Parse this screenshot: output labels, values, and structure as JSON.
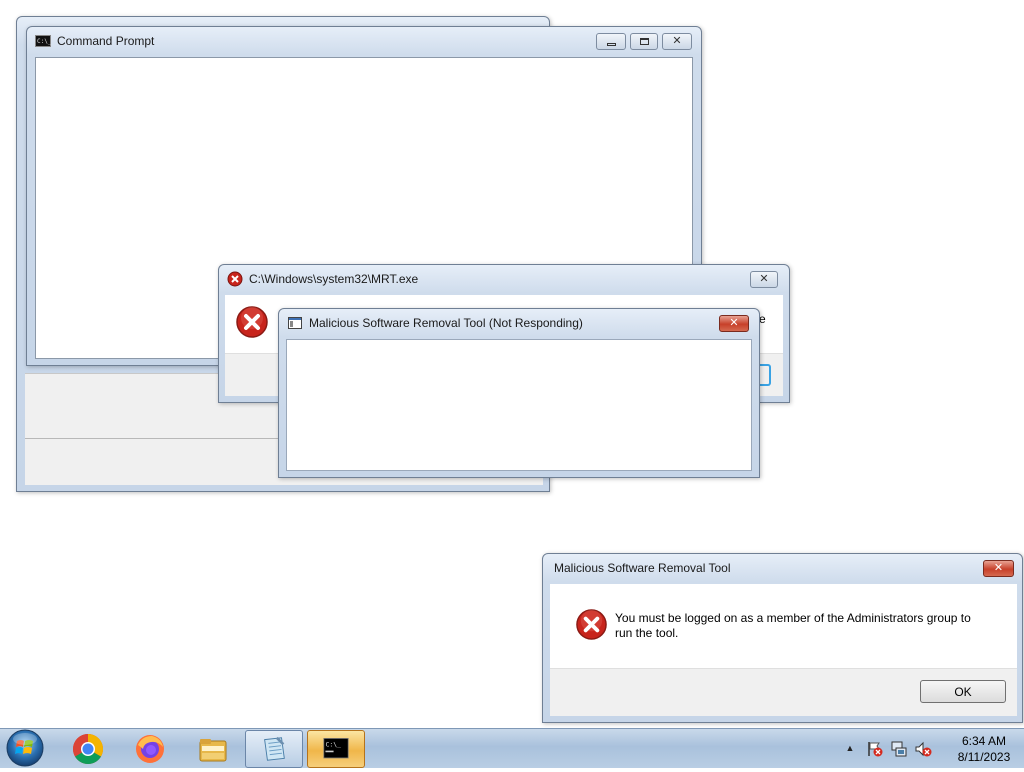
{
  "windows": {
    "cmd": {
      "title": "Command Prompt"
    },
    "mrt_exe": {
      "title": "C:\\Windows\\system32\\MRT.exe",
      "partial_text": "e"
    },
    "mrt_not_responding": {
      "title": "Malicious Software Removal Tool (Not Responding)"
    },
    "mrt_dialog": {
      "title": "Malicious Software Removal Tool",
      "message_line1": "You must be logged on as a member of the Administrators group to",
      "message_line2": "run the tool.",
      "ok_label": "OK"
    }
  },
  "taskbar": {
    "items": [
      "start-orb",
      "chrome",
      "firefox",
      "file-explorer",
      "notepad",
      "command-prompt"
    ],
    "tray_icons": [
      "show-hidden-icons-arrow",
      "action-center-flag-icon",
      "network-icon",
      "volume-muted-icon"
    ],
    "clock": {
      "time": "6:34 AM",
      "date": "8/11/2023"
    }
  },
  "colors": {
    "accent_red": "#c7402a",
    "taskbar": "#b9cee4",
    "active_item": "#f0b64a"
  }
}
